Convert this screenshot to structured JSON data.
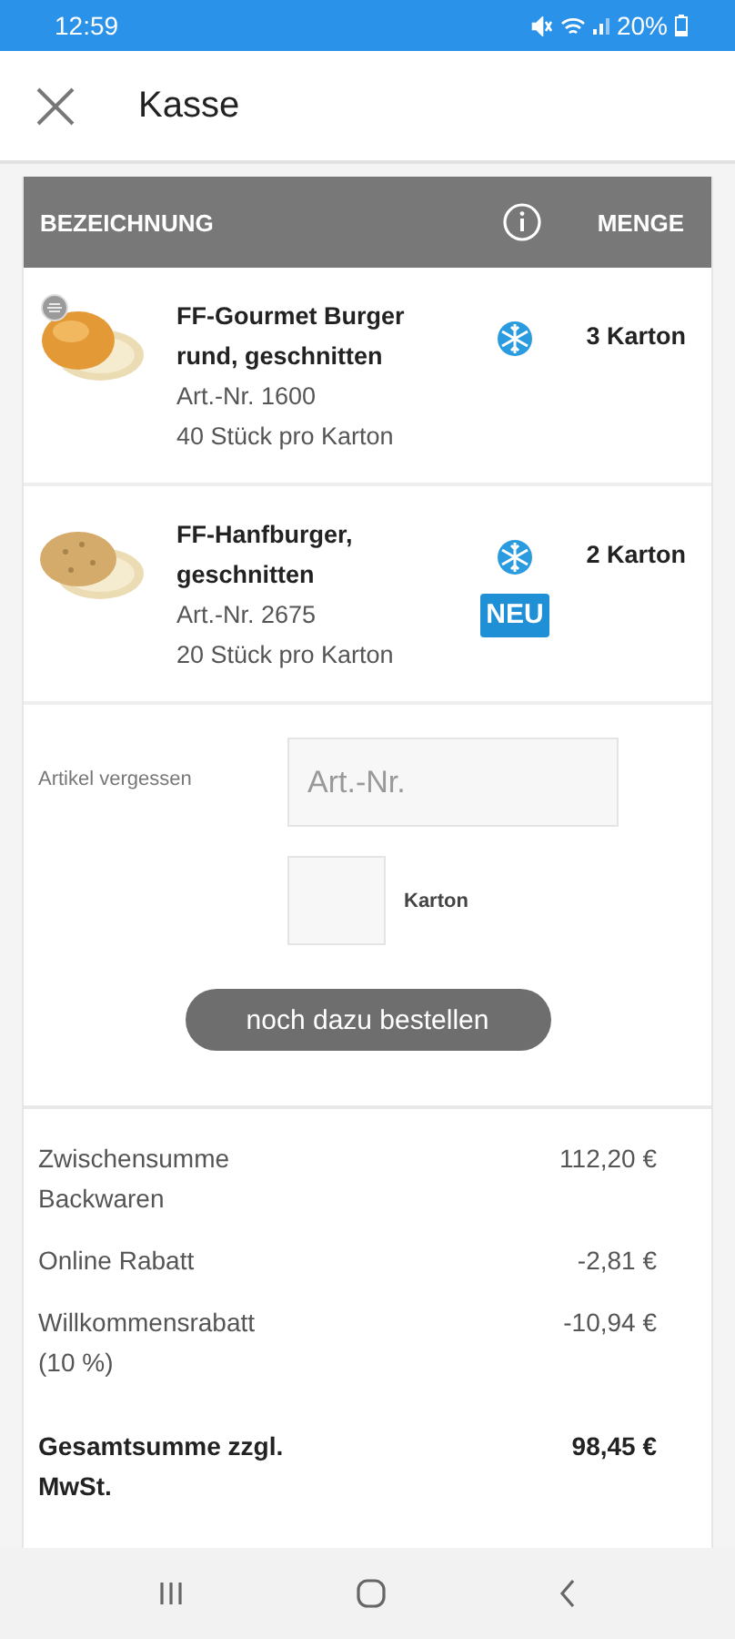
{
  "status_bar": {
    "time": "12:59",
    "battery": "20%"
  },
  "header": {
    "title": "Kasse"
  },
  "table": {
    "columns": [
      "BEZEICHNUNG",
      "MENGE"
    ],
    "rows": [
      {
        "name": "FF-Gourmet Burger rund, geschnitten",
        "article": "Art.-Nr. 1600",
        "pack": "40 Stück pro Karton",
        "quantity": "3 Karton",
        "seal": true,
        "frozen": true,
        "new_badge": null,
        "kind": "plain"
      },
      {
        "name": "FF-Hanfburger, geschnitten",
        "article": "Art.-Nr. 2675",
        "pack": "20 Stück pro Karton",
        "quantity": "2 Karton",
        "seal": false,
        "frozen": true,
        "new_badge": "NEU",
        "kind": "seeded"
      }
    ]
  },
  "forgot": {
    "label": "Artikel vergessen",
    "article_placeholder": "Art.-Nr.",
    "unit": "Karton",
    "button": "noch dazu bestellen"
  },
  "totals": [
    {
      "label": "Zwischensumme Backwaren",
      "value": "112,20 €",
      "emphasis": false
    },
    {
      "label": "Online Rabatt",
      "value": "-2,81 €",
      "emphasis": false
    },
    {
      "label": "Willkommensrabatt (10 %)",
      "value": "-10,94 €",
      "emphasis": false
    },
    {
      "label": "Gesamtsumme zzgl. MwSt.",
      "value": "98,45 €",
      "emphasis": true
    }
  ]
}
